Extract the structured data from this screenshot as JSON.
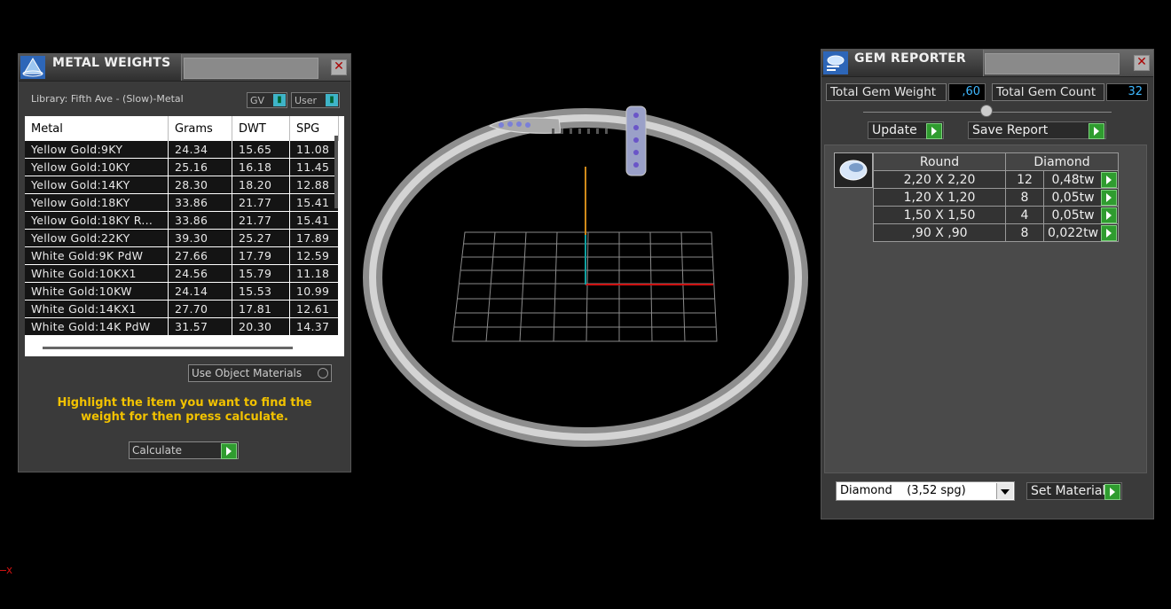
{
  "metal_weights": {
    "title": "METAL WEIGHTS",
    "library_label": "Library: Fifth Ave - (Slow)-Metal",
    "gv_label": "GV",
    "user_label": "User",
    "columns": [
      "Metal",
      "Grams",
      "DWT",
      "SPG"
    ],
    "rows": [
      [
        "Yellow Gold:9KY",
        "24.34",
        "15.65",
        "11.08"
      ],
      [
        "Yellow Gold:10KY",
        "25.16",
        "16.18",
        "11.45"
      ],
      [
        "Yellow Gold:14KY",
        "28.30",
        "18.20",
        "12.88"
      ],
      [
        "Yellow Gold:18KY",
        "33.86",
        "21.77",
        "15.41"
      ],
      [
        "Yellow Gold:18KY R...",
        "33.86",
        "21.77",
        "15.41"
      ],
      [
        "Yellow Gold:22KY",
        "39.30",
        "25.27",
        "17.89"
      ],
      [
        "White Gold:9K PdW",
        "27.66",
        "17.79",
        "12.59"
      ],
      [
        "White Gold:10KX1",
        "24.56",
        "15.79",
        "11.18"
      ],
      [
        "White Gold:10KW",
        "24.14",
        "15.53",
        "10.99"
      ],
      [
        "White Gold:14KX1",
        "27.70",
        "17.81",
        "12.61"
      ],
      [
        "White Gold:14K PdW",
        "31.57",
        "20.30",
        "14.37"
      ]
    ],
    "use_object_materials": "Use Object Materials",
    "hint": "Highlight the item you want to find the weight for then press calculate.",
    "calculate_label": "Calculate"
  },
  "gem_reporter": {
    "title": "GEM REPORTER",
    "total_weight_label": "Total Gem Weight",
    "total_weight_value": ",60",
    "total_count_label": "Total Gem Count",
    "total_count_value": "32",
    "update_label": "Update",
    "save_report_label": "Save Report",
    "table_header": [
      "Round",
      "Diamond"
    ],
    "gems": [
      [
        "2,20 X 2,20",
        "12",
        "0,48tw"
      ],
      [
        "1,20 X 1,20",
        "8",
        "0,05tw"
      ],
      [
        "1,50 X 1,50",
        "4",
        "0,05tw"
      ],
      [
        ",90 X ,90",
        "8",
        "0,022tw"
      ]
    ],
    "material_select": "Diamond    (3,52 spg)",
    "set_material_label": "Set Material"
  },
  "axis_label": "x",
  "colors": {
    "accent_green": "#2f9c2f",
    "hint_yellow": "#f2c200",
    "value_blue": "#3fb8ff"
  }
}
